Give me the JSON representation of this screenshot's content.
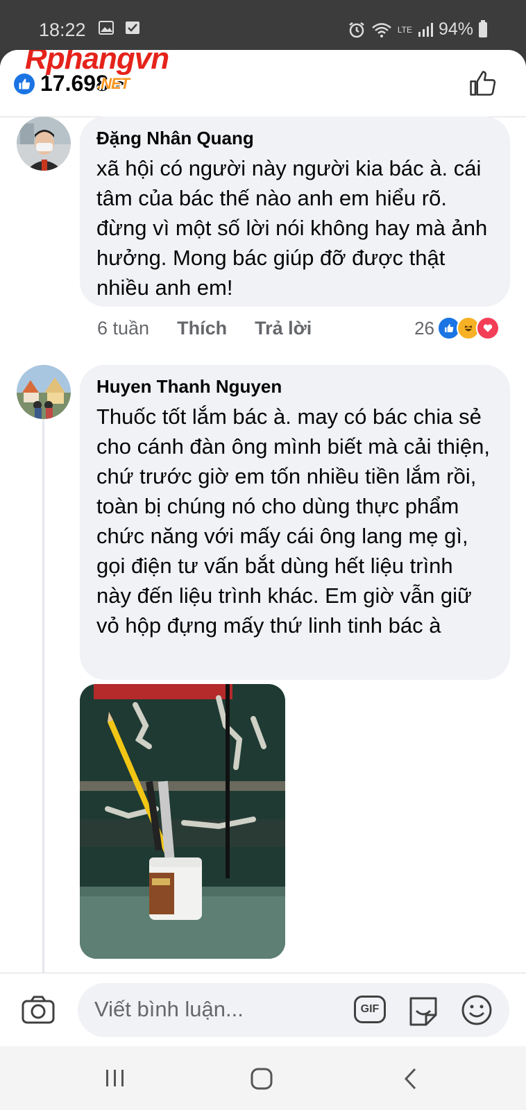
{
  "status_bar": {
    "time": "18:22",
    "battery": "94%",
    "network": "LTE"
  },
  "watermark": {
    "brand": "Rphangvn",
    "suffix": ".NET"
  },
  "header": {
    "reaction_count": "17.698",
    "chevron": ">",
    "like_icon": "thumbs-up-outline-icon"
  },
  "comments": [
    {
      "author": "Đặng Nhân Quang",
      "text": "xã hội có người này người kia bác à. cái tâm của bác thế nào anh em hiểu rõ. đừng vì một số lời nói không hay mà ảnh hưởng. Mong bác giúp đỡ được thật nhiều anh em!",
      "time": "6 tuần",
      "like_label": "Thích",
      "reply_label": "Trả lời",
      "reaction_count": "26",
      "reactions": [
        "like",
        "haha",
        "love"
      ]
    },
    {
      "author": "Huyen Thanh Nguyen",
      "text": "Thuốc tốt lắm bác à. may có bác chia sẻ cho cánh đàn ông mình biết mà cải thiện, chứ trước giờ em tốn nhiều tiền lắm rồi, toàn bị chúng nó cho dùng thực phẩm chức năng với mấy cái ông lang mẹ gì, gọi điện tư vấn bắt dùng hết liệu trình này đến liệu trình khác. Em giờ vẫn giữ vỏ hộp đựng mấy thứ linh tinh bác à",
      "has_photo": true
    }
  ],
  "composer": {
    "placeholder": "Viết bình luận...",
    "gif_label": "GIF"
  },
  "nav": {
    "icons": [
      "recent-apps-icon",
      "home-icon",
      "back-icon"
    ]
  },
  "colors": {
    "facebook_blue": "#1b74e4",
    "bubble_bg": "#f0f2f5",
    "secondary_text": "#65676b",
    "watermark_red": "#e5231b",
    "watermark_orange": "#f7941d"
  }
}
